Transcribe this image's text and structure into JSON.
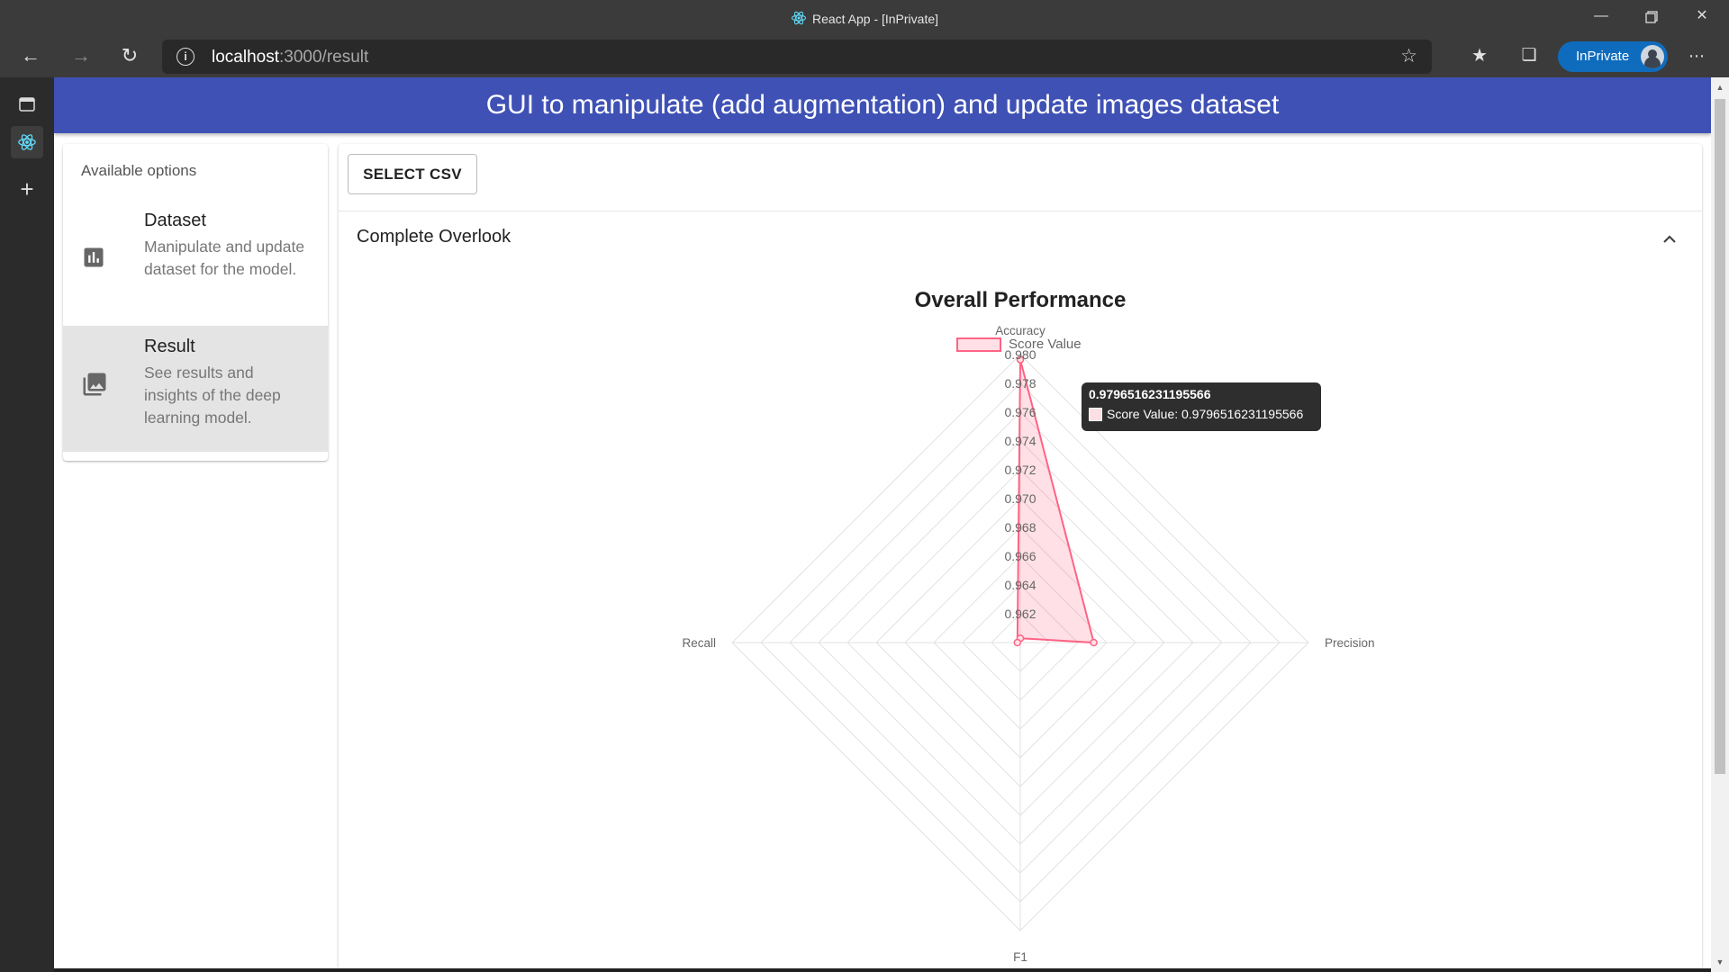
{
  "browser": {
    "window_title": "React App - [InPrivate]",
    "url_host": "localhost",
    "url_path": ":3000/result",
    "inprivate_label": "InPrivate",
    "icons": [
      "back-icon",
      "forward-icon",
      "refresh-icon",
      "info-icon",
      "add-favorite-icon",
      "favorites-icon",
      "collections-icon",
      "more-icon",
      "minimize-icon",
      "restore-icon",
      "close-icon"
    ]
  },
  "app": {
    "title": "GUI to manipulate (add augmentation) and update images dataset"
  },
  "sidebar": {
    "subheader": "Available options",
    "items": [
      {
        "title": "Dataset",
        "description": "Manipulate and update dataset for the model.",
        "icon": "bar-chart-icon",
        "selected": false
      },
      {
        "title": "Result",
        "description": "See results and insights of the deep learning model.",
        "icon": "photo-library-icon",
        "selected": true
      }
    ]
  },
  "content": {
    "select_csv_label": "SELECT CSV",
    "accordion_title": "Complete Overlook"
  },
  "colors": {
    "app_bar": "#3f51b5",
    "series_border": "#ff6384",
    "series_fill": "rgba(255,99,132,0.2)"
  },
  "chart_data": {
    "type": "radar",
    "title": "Overall Performance",
    "labels": [
      "Accuracy",
      "Precision",
      "F1",
      "Recall"
    ],
    "series": [
      {
        "name": "Score Value",
        "values": [
          0.9796516231195566,
          0.9651,
          0.9597,
          0.9602
        ]
      }
    ],
    "scale_min": 0.96,
    "scale_max": 0.98,
    "ticks": [
      "0.962",
      "0.964",
      "0.966",
      "0.968",
      "0.970",
      "0.972",
      "0.974",
      "0.976",
      "0.978",
      "0.980"
    ],
    "legend_position": "top",
    "grid": true,
    "tooltip": {
      "title": "0.9796516231195566",
      "body": "Score Value: 0.9796516231195566"
    }
  }
}
